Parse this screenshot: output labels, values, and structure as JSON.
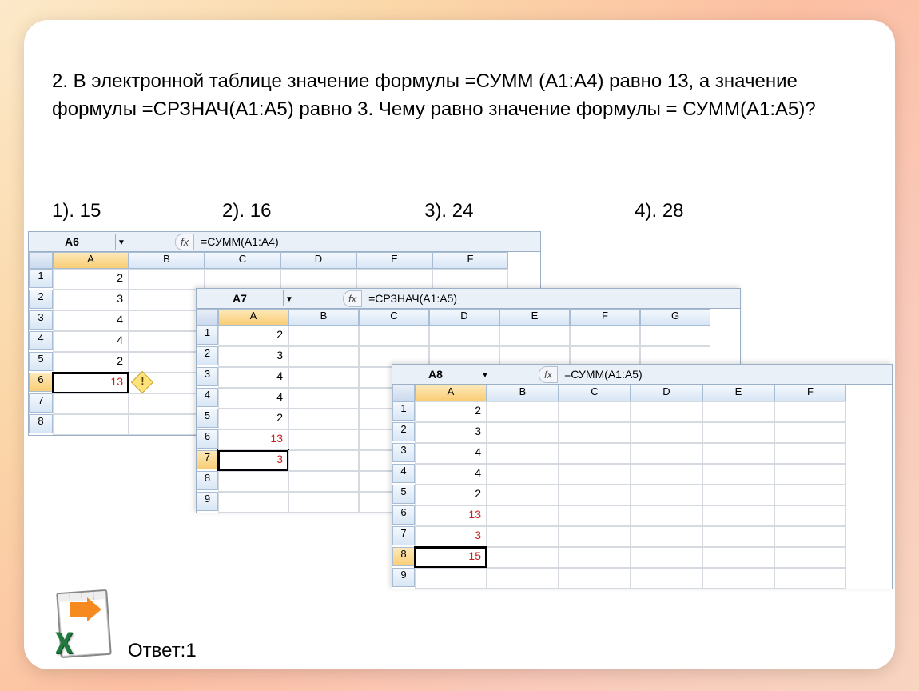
{
  "question": "2. В электронной таблице значение формулы  =СУММ (А1:А4) равно 13, а значение формулы =СРЗНАЧ(А1:А5) равно 3. Чему равно значение формулы = СУММ(А1:А5)?",
  "options": {
    "o1": "1). 15",
    "o2": "2). 16",
    "o3": "3). 24",
    "o4": "4). 28"
  },
  "fx_label": "fx",
  "sheet1": {
    "cellref": "A6",
    "formula": "=СУММ(A1:A4)",
    "cols": [
      "A",
      "B",
      "C",
      "D",
      "E",
      "F"
    ],
    "rows": [
      "1",
      "2",
      "3",
      "4",
      "5",
      "6",
      "7",
      "8"
    ],
    "vals": {
      "a1": "2",
      "a2": "3",
      "a3": "4",
      "a4": "4",
      "a5": "2",
      "a6": "13"
    }
  },
  "sheet2": {
    "cellref": "A7",
    "formula": "=СРЗНАЧ(A1:A5)",
    "cols": [
      "A",
      "B",
      "C",
      "D",
      "E",
      "F",
      "G"
    ],
    "rows": [
      "1",
      "2",
      "3",
      "4",
      "5",
      "6",
      "7",
      "8",
      "9"
    ],
    "vals": {
      "a1": "2",
      "a2": "3",
      "a3": "4",
      "a4": "4",
      "a5": "2",
      "a6": "13",
      "a7": "3"
    }
  },
  "sheet3": {
    "cellref": "A8",
    "formula": "=СУММ(A1:A5)",
    "cols": [
      "A",
      "B",
      "C",
      "D",
      "E",
      "F"
    ],
    "rows": [
      "1",
      "2",
      "3",
      "4",
      "5",
      "6",
      "7",
      "8",
      "9"
    ],
    "vals": {
      "a1": "2",
      "a2": "3",
      "a3": "4",
      "a4": "4",
      "a5": "2",
      "a6": "13",
      "a7": "3",
      "a8": "15"
    }
  },
  "answer": "Ответ:1"
}
